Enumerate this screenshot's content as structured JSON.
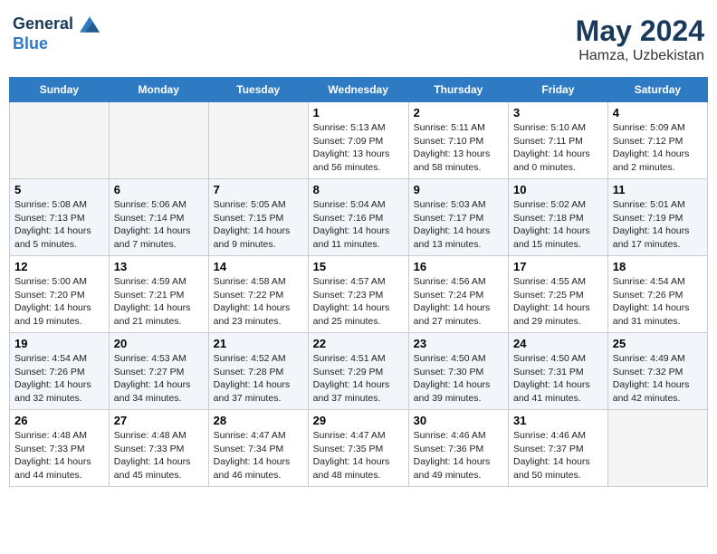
{
  "header": {
    "logo_line1": "General",
    "logo_line2": "Blue",
    "month_year": "May 2024",
    "location": "Hamza, Uzbekistan"
  },
  "days_of_week": [
    "Sunday",
    "Monday",
    "Tuesday",
    "Wednesday",
    "Thursday",
    "Friday",
    "Saturday"
  ],
  "weeks": [
    [
      {
        "day": "",
        "info": ""
      },
      {
        "day": "",
        "info": ""
      },
      {
        "day": "",
        "info": ""
      },
      {
        "day": "1",
        "info": "Sunrise: 5:13 AM\nSunset: 7:09 PM\nDaylight: 13 hours\nand 56 minutes."
      },
      {
        "day": "2",
        "info": "Sunrise: 5:11 AM\nSunset: 7:10 PM\nDaylight: 13 hours\nand 58 minutes."
      },
      {
        "day": "3",
        "info": "Sunrise: 5:10 AM\nSunset: 7:11 PM\nDaylight: 14 hours\nand 0 minutes."
      },
      {
        "day": "4",
        "info": "Sunrise: 5:09 AM\nSunset: 7:12 PM\nDaylight: 14 hours\nand 2 minutes."
      }
    ],
    [
      {
        "day": "5",
        "info": "Sunrise: 5:08 AM\nSunset: 7:13 PM\nDaylight: 14 hours\nand 5 minutes."
      },
      {
        "day": "6",
        "info": "Sunrise: 5:06 AM\nSunset: 7:14 PM\nDaylight: 14 hours\nand 7 minutes."
      },
      {
        "day": "7",
        "info": "Sunrise: 5:05 AM\nSunset: 7:15 PM\nDaylight: 14 hours\nand 9 minutes."
      },
      {
        "day": "8",
        "info": "Sunrise: 5:04 AM\nSunset: 7:16 PM\nDaylight: 14 hours\nand 11 minutes."
      },
      {
        "day": "9",
        "info": "Sunrise: 5:03 AM\nSunset: 7:17 PM\nDaylight: 14 hours\nand 13 minutes."
      },
      {
        "day": "10",
        "info": "Sunrise: 5:02 AM\nSunset: 7:18 PM\nDaylight: 14 hours\nand 15 minutes."
      },
      {
        "day": "11",
        "info": "Sunrise: 5:01 AM\nSunset: 7:19 PM\nDaylight: 14 hours\nand 17 minutes."
      }
    ],
    [
      {
        "day": "12",
        "info": "Sunrise: 5:00 AM\nSunset: 7:20 PM\nDaylight: 14 hours\nand 19 minutes."
      },
      {
        "day": "13",
        "info": "Sunrise: 4:59 AM\nSunset: 7:21 PM\nDaylight: 14 hours\nand 21 minutes."
      },
      {
        "day": "14",
        "info": "Sunrise: 4:58 AM\nSunset: 7:22 PM\nDaylight: 14 hours\nand 23 minutes."
      },
      {
        "day": "15",
        "info": "Sunrise: 4:57 AM\nSunset: 7:23 PM\nDaylight: 14 hours\nand 25 minutes."
      },
      {
        "day": "16",
        "info": "Sunrise: 4:56 AM\nSunset: 7:24 PM\nDaylight: 14 hours\nand 27 minutes."
      },
      {
        "day": "17",
        "info": "Sunrise: 4:55 AM\nSunset: 7:25 PM\nDaylight: 14 hours\nand 29 minutes."
      },
      {
        "day": "18",
        "info": "Sunrise: 4:54 AM\nSunset: 7:26 PM\nDaylight: 14 hours\nand 31 minutes."
      }
    ],
    [
      {
        "day": "19",
        "info": "Sunrise: 4:54 AM\nSunset: 7:26 PM\nDaylight: 14 hours\nand 32 minutes."
      },
      {
        "day": "20",
        "info": "Sunrise: 4:53 AM\nSunset: 7:27 PM\nDaylight: 14 hours\nand 34 minutes."
      },
      {
        "day": "21",
        "info": "Sunrise: 4:52 AM\nSunset: 7:28 PM\nDaylight: 14 hours\nand 37 minutes."
      },
      {
        "day": "22",
        "info": "Sunrise: 4:51 AM\nSunset: 7:29 PM\nDaylight: 14 hours\nand 37 minutes."
      },
      {
        "day": "23",
        "info": "Sunrise: 4:50 AM\nSunset: 7:30 PM\nDaylight: 14 hours\nand 39 minutes."
      },
      {
        "day": "24",
        "info": "Sunrise: 4:50 AM\nSunset: 7:31 PM\nDaylight: 14 hours\nand 41 minutes."
      },
      {
        "day": "25",
        "info": "Sunrise: 4:49 AM\nSunset: 7:32 PM\nDaylight: 14 hours\nand 42 minutes."
      }
    ],
    [
      {
        "day": "26",
        "info": "Sunrise: 4:48 AM\nSunset: 7:33 PM\nDaylight: 14 hours\nand 44 minutes."
      },
      {
        "day": "27",
        "info": "Sunrise: 4:48 AM\nSunset: 7:33 PM\nDaylight: 14 hours\nand 45 minutes."
      },
      {
        "day": "28",
        "info": "Sunrise: 4:47 AM\nSunset: 7:34 PM\nDaylight: 14 hours\nand 46 minutes."
      },
      {
        "day": "29",
        "info": "Sunrise: 4:47 AM\nSunset: 7:35 PM\nDaylight: 14 hours\nand 48 minutes."
      },
      {
        "day": "30",
        "info": "Sunrise: 4:46 AM\nSunset: 7:36 PM\nDaylight: 14 hours\nand 49 minutes."
      },
      {
        "day": "31",
        "info": "Sunrise: 4:46 AM\nSunset: 7:37 PM\nDaylight: 14 hours\nand 50 minutes."
      },
      {
        "day": "",
        "info": ""
      }
    ]
  ]
}
